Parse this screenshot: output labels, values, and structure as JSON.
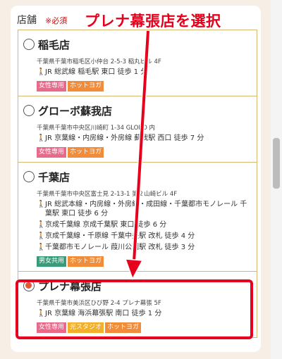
{
  "field": {
    "label": "店舗",
    "required": "※必須"
  },
  "annotation": "プレナ幕張店を選択",
  "stores": [
    {
      "name": "稲毛店",
      "selected": false,
      "address": "千葉県千葉市稲毛区小仲台 2-5-3 稲丸ビル 4F",
      "access": [
        "JR 総武線 稲毛駅 東口 徒歩 1 分"
      ],
      "tags": [
        {
          "label": "女性専用",
          "kind": "women"
        },
        {
          "label": "ホットヨガ",
          "kind": "hot"
        }
      ]
    },
    {
      "name": "グローボ蘇我店",
      "selected": false,
      "address": "千葉県千葉市中央区川崎町 1-34 GLOBO 内",
      "access": [
        "JR 京葉線・内房線・外房線 蘇我駅 西口 徒歩 7 分"
      ],
      "tags": [
        {
          "label": "女性専用",
          "kind": "women"
        },
        {
          "label": "ホットヨガ",
          "kind": "hot"
        }
      ]
    },
    {
      "name": "千葉店",
      "selected": false,
      "address": "千葉県千葉市中央区富士見 2-13-1 第２山崎ビル 4F",
      "access": [
        "JR 総武本線・内房線・外房線・成田線・千葉都市モノレール 千葉駅 東口 徒歩 6 分",
        "京成千葉線 京成千葉駅 東口 徒歩 6 分",
        "京成千葉線・千原線 千葉中央駅 改札 徒歩 4 分",
        "千葉都市モノレール 葭川公園駅 改札 徒歩 3 分"
      ],
      "tags": [
        {
          "label": "男女共用",
          "kind": "mixed"
        },
        {
          "label": "ホットヨガ",
          "kind": "hot"
        }
      ]
    },
    {
      "name": "プレナ幕張店",
      "selected": true,
      "address": "千葉県千葉市美浜区ひび野 2-4 プレナ幕張 5F",
      "access": [
        "JR 京葉線 海浜幕張駅 南口 徒歩 1 分"
      ],
      "tags": [
        {
          "label": "女性専用",
          "kind": "women"
        },
        {
          "label": "光スタジオ",
          "kind": "light"
        },
        {
          "label": "ホットヨガ",
          "kind": "hot"
        }
      ]
    }
  ],
  "colors": {
    "accent": "#e6001c",
    "border": "#d6b770",
    "radio_checked": "#e05a3a"
  }
}
